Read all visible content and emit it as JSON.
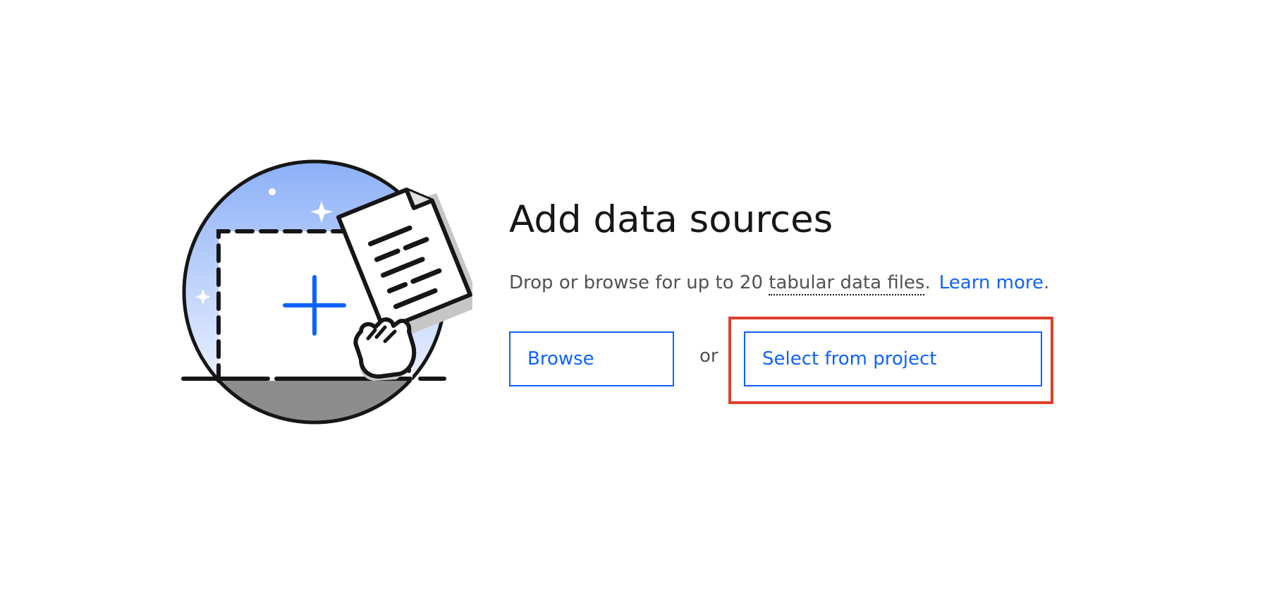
{
  "empty_state": {
    "title": "Add data sources",
    "description_prefix": "Drop or browse for up to 20 ",
    "description_term": "tabular data files",
    "description_suffix": ".",
    "learn_more_label": "Learn more",
    "learn_more_suffix": ".",
    "illustration_icon": "add-data-illustration"
  },
  "actions": {
    "browse_label": "Browse",
    "or_label": "or",
    "select_from_project_label": "Select from project"
  },
  "colors": {
    "accent": "#0f62fe",
    "highlight": "#e0402d",
    "text_primary": "#161616",
    "text_secondary": "#525252"
  }
}
